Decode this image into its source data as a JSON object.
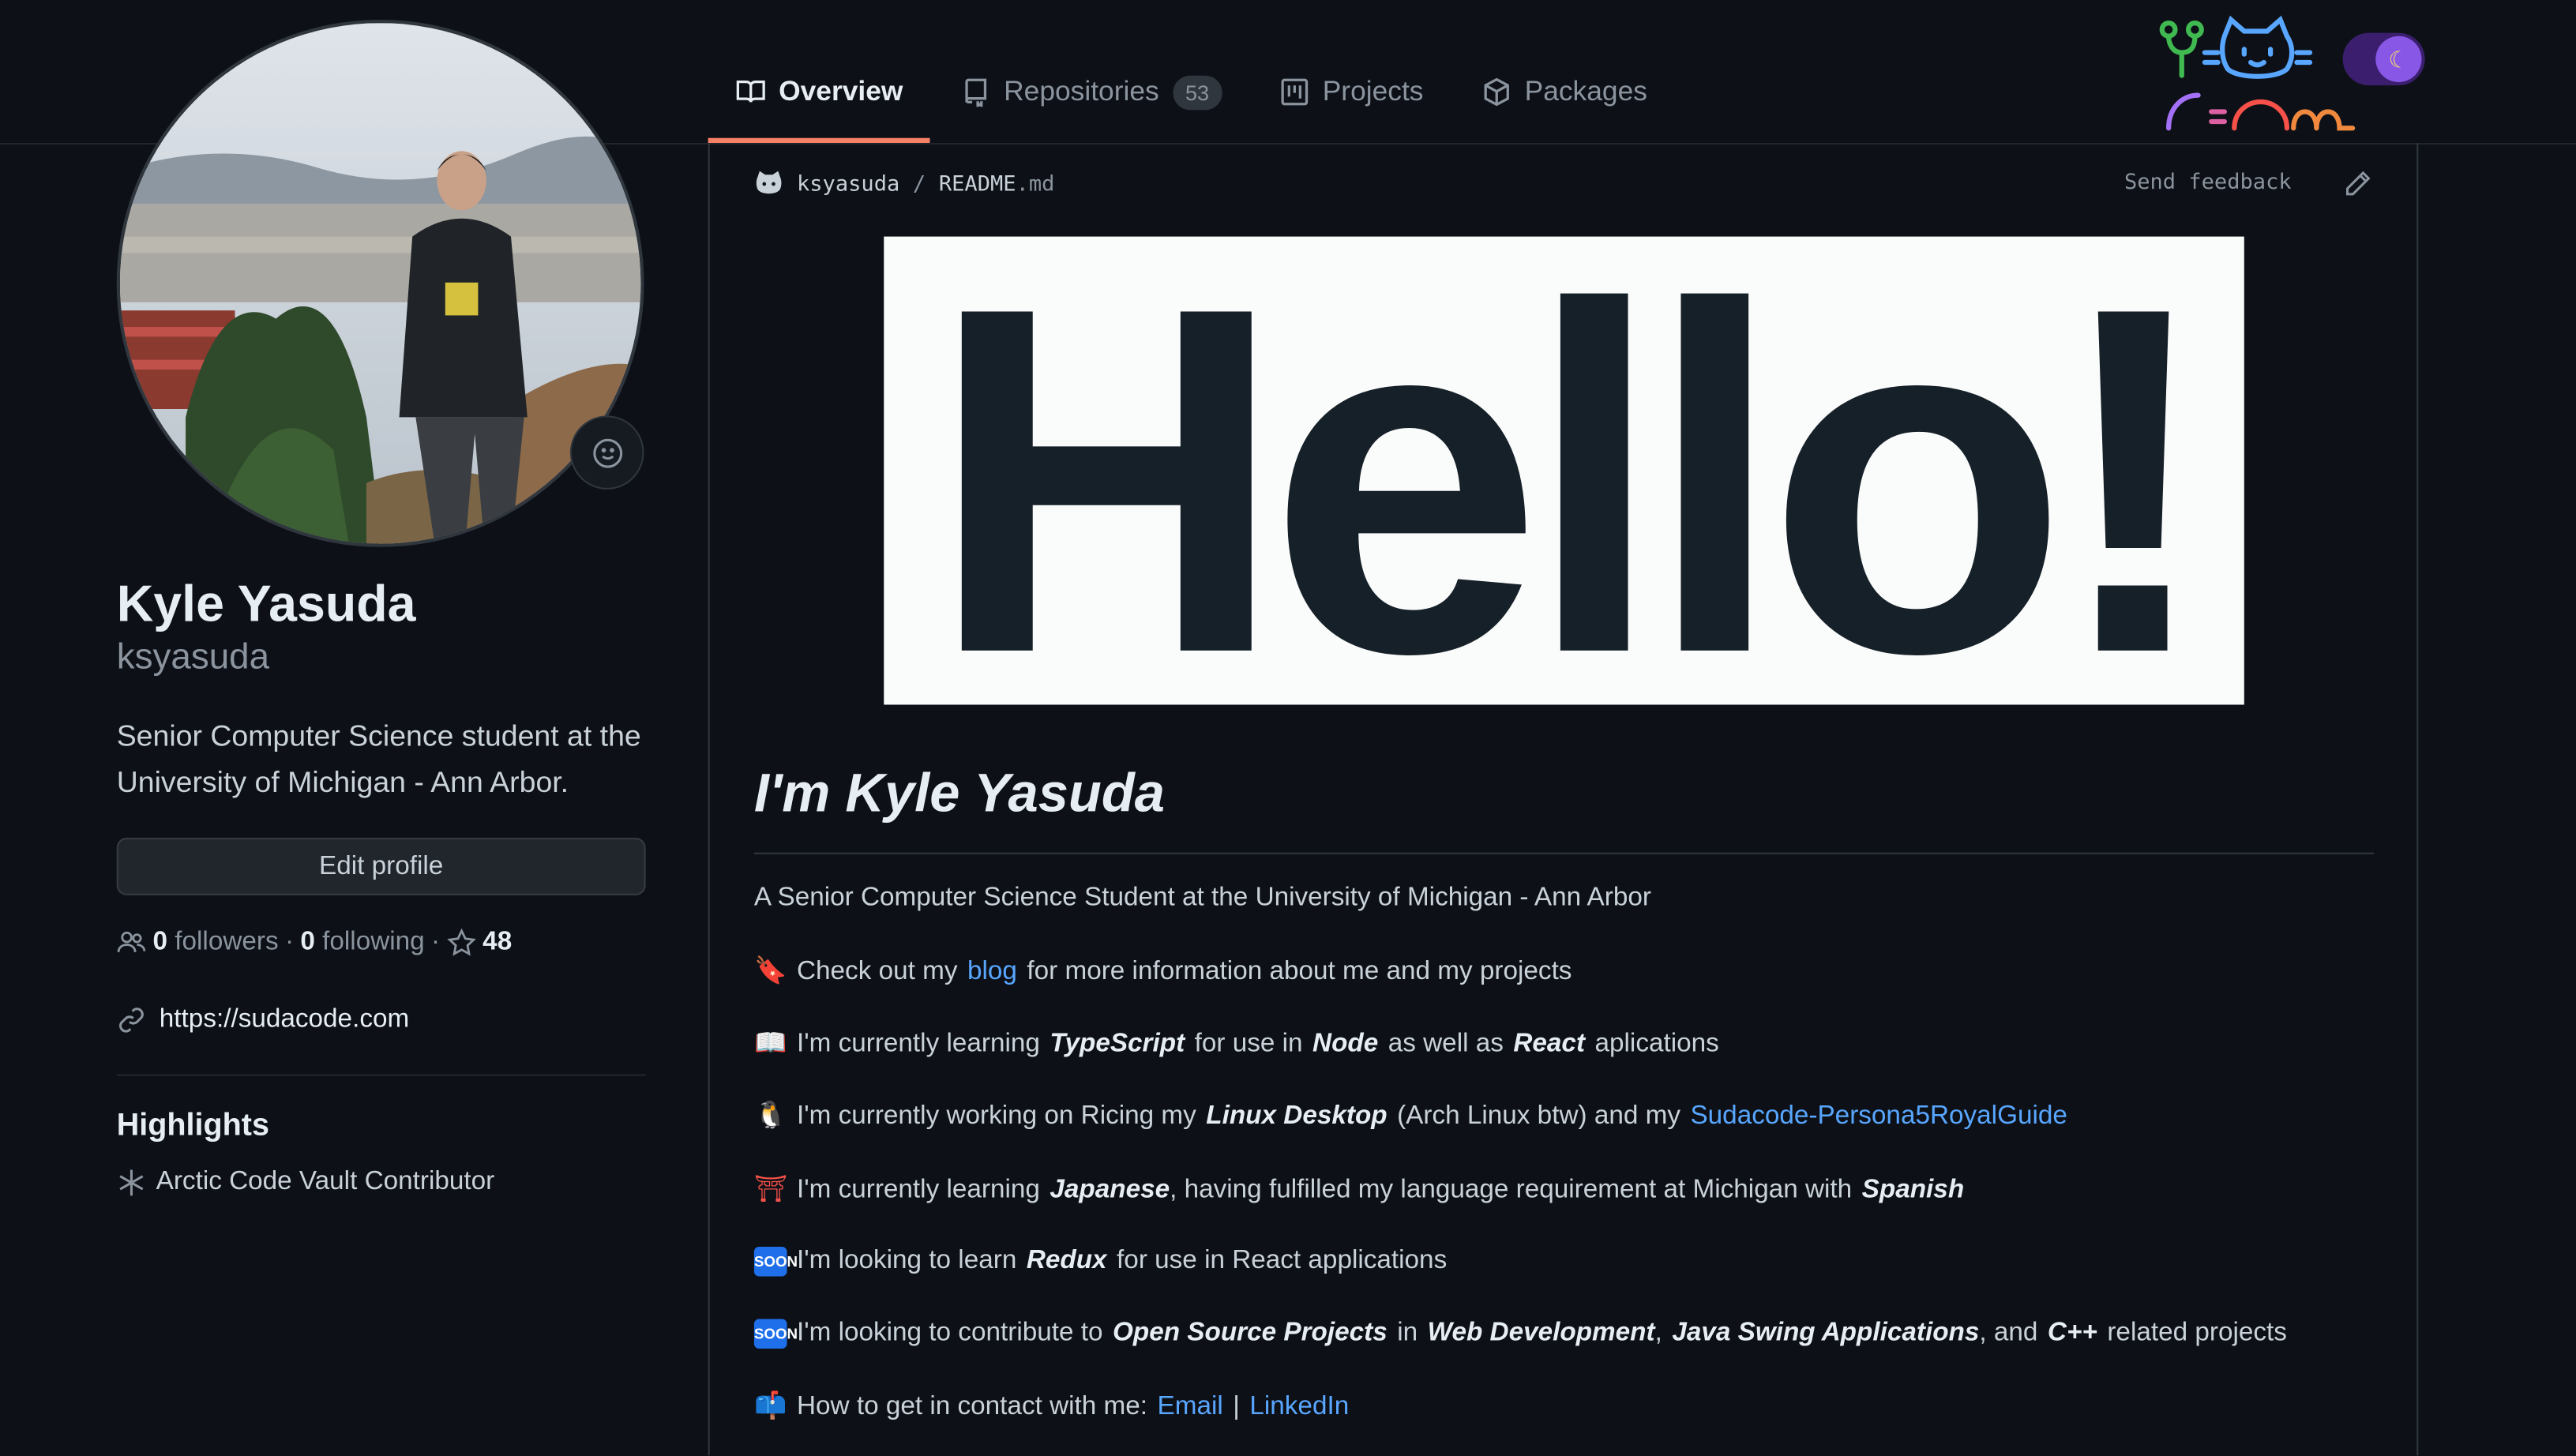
{
  "nav": {
    "tabs": [
      {
        "label": "Overview",
        "icon": "book-icon"
      },
      {
        "label": "Repositories",
        "icon": "repo-icon",
        "count": "53"
      },
      {
        "label": "Projects",
        "icon": "project-icon"
      },
      {
        "label": "Packages",
        "icon": "package-icon"
      }
    ]
  },
  "profile": {
    "name": "Kyle Yasuda",
    "login": "ksyasuda",
    "bio": "Senior Computer Science student at the University of Michigan - Ann Arbor.",
    "edit_label": "Edit profile",
    "followers_count": "0",
    "followers_label": "followers",
    "following_count": "0",
    "following_label": "following",
    "stars": "48",
    "website": "https://sudacode.com",
    "highlights_title": "Highlights",
    "highlight_item": "Arctic Code Vault Contributor"
  },
  "readme": {
    "owner": "ksyasuda",
    "separator": "/",
    "file_name": "README",
    "file_ext": ".md",
    "feedback_label": "Send feedback",
    "banner_text": "Hello!",
    "heading": "I'm Kyle Yasuda",
    "intro": "A Senior Computer Science Student at the University of Michigan - Ann Arbor",
    "l1": {
      "emoji": "🔖",
      "a": "Check out my",
      "link": "blog",
      "b": "for more information about me and my projects"
    },
    "l2": {
      "emoji": "📖",
      "a": "I'm currently learning",
      "em1": "TypeScript",
      "b": "for use in",
      "em2": "Node",
      "c": "as well as",
      "em3": "React",
      "d": "aplications"
    },
    "l3": {
      "emoji": "🐧",
      "a": "I'm currently working on Ricing my",
      "em1": "Linux Desktop",
      "b": "(Arch Linux btw) and my",
      "link": "Sudacode-Persona5RoyalGuide"
    },
    "l4": {
      "emoji": "⛩",
      "a": "I'm currently learning",
      "em1": "Japanese",
      "b": ", having fulfilled my language requirement at Michigan with",
      "em2": "Spanish"
    },
    "l5": {
      "emoji": "SOON",
      "a": "I'm looking to learn",
      "em1": "Redux",
      "b": "for use in React applications"
    },
    "l6": {
      "emoji": "SOON",
      "a": "I'm looking to contribute to",
      "em1": "Open Source Projects",
      "b": "in",
      "em2": "Web Development",
      "c": ",",
      "em3": "Java Swing Applications",
      "d": ", and",
      "em4": "C++",
      "e": "related projects"
    },
    "l7": {
      "emoji": "📫",
      "a": "How to get in contact with me:",
      "link1": "Email",
      "sep": "|",
      "link2": "LinkedIn"
    }
  },
  "theme": {
    "accent": "#f78166",
    "link": "#58a6ff",
    "background": "#0d1117"
  }
}
